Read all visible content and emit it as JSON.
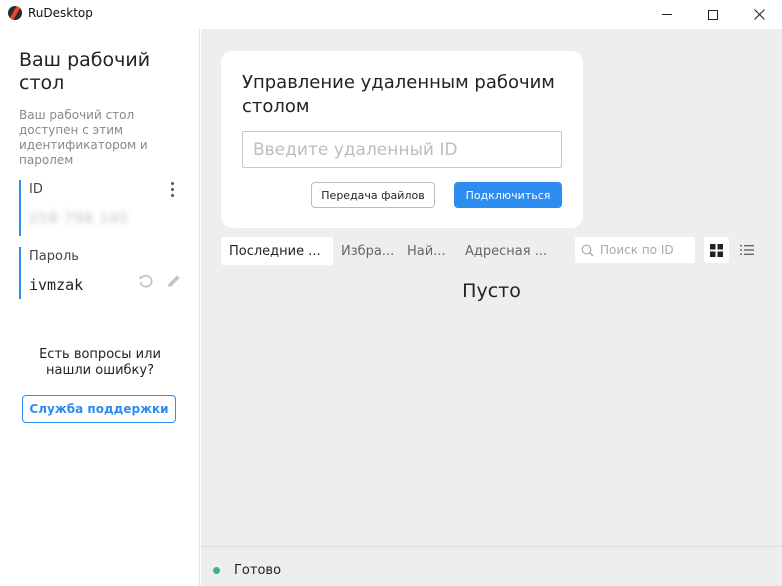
{
  "window": {
    "title": "RuDesktop",
    "minimize_icon": "minimize-icon",
    "maximize_icon": "maximize-icon",
    "close_icon": "close-icon"
  },
  "sidebar": {
    "title": "Ваш рабочий стол",
    "description": "Ваш рабочий стол доступен с этим идентификатором и паролем",
    "id_label": "ID",
    "id_value": "258 798 145",
    "password_label": "Пароль",
    "password_value": "ivmzak",
    "question_text": "Есть вопросы или нашли ошибку?",
    "support_button": "Служба поддержки"
  },
  "remote_card": {
    "title": "Управление удаленным рабочим столом",
    "input_placeholder": "Введите удаленный ID",
    "files_button": "Передача файлов",
    "connect_button": "Подключиться"
  },
  "tabs": [
    {
      "label": "Последние ...",
      "active": true
    },
    {
      "label": "Избра...",
      "active": false
    },
    {
      "label": "Най...",
      "active": false
    },
    {
      "label": "Адресная ...",
      "active": false
    }
  ],
  "search": {
    "placeholder": "Поиск по ID"
  },
  "empty_state": "Пусто",
  "status": {
    "text": "Готово",
    "dot_color": "#3cb48c"
  },
  "colors": {
    "accent": "#2d8cf0",
    "logo_red": "#e8472c"
  }
}
